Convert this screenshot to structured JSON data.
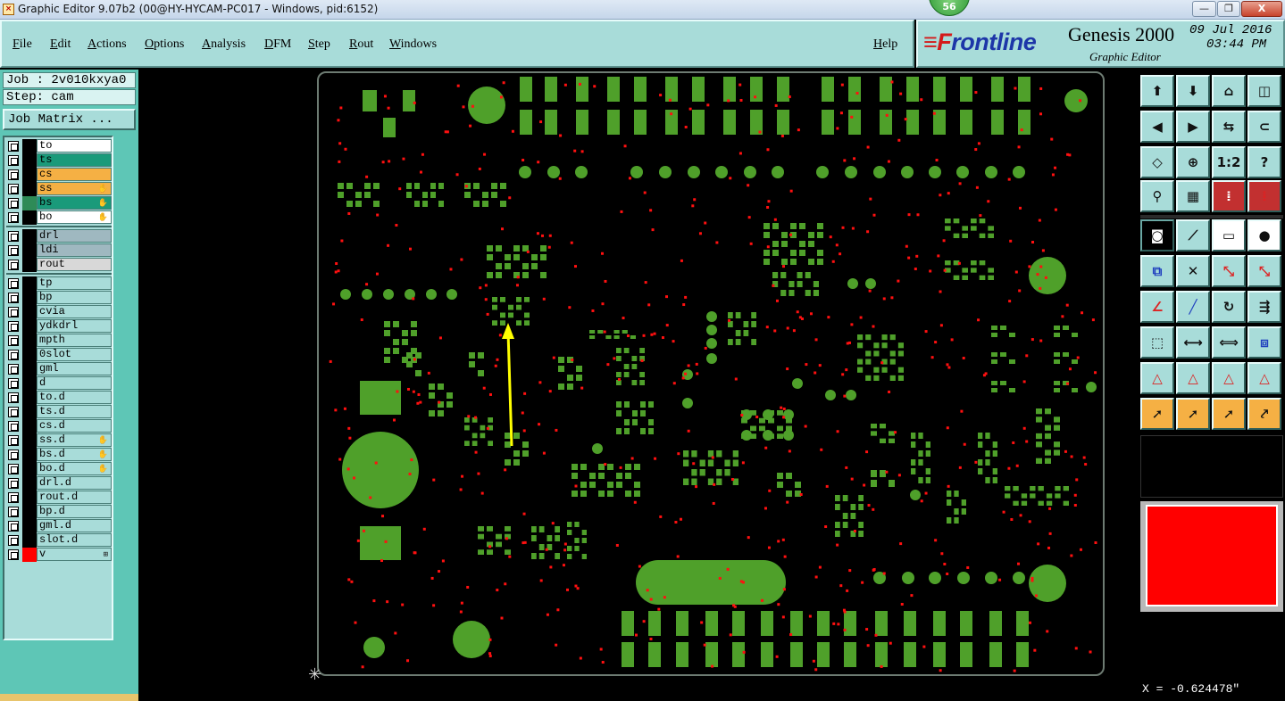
{
  "window": {
    "title": "Graphic Editor 9.07b2 (00@HY-HYCAM-PC017 - Windows, pid:6152)",
    "badge": "56",
    "min_label": "—",
    "max_label": "❐",
    "close_label": "X"
  },
  "menu": {
    "items": [
      "File",
      "Edit",
      "Actions",
      "Options",
      "Analysis",
      "DFM",
      "Step",
      "Rout",
      "Windows"
    ],
    "help": "Help"
  },
  "brand": {
    "logo_f": "≡F",
    "logo_rest": "rontline",
    "product": "Genesis 2000",
    "subtitle": "Graphic Editor",
    "date": "09 Jul 2016",
    "time": "03:44 PM"
  },
  "job": {
    "job_line": "Job : 2v010kxya0",
    "step_line": "Step: cam",
    "matrix_button": "Job Matrix ..."
  },
  "layers": {
    "board": [
      {
        "name": "to",
        "bg": "#ffffff",
        "swatch": "#000000",
        "flag": ""
      },
      {
        "name": "ts",
        "bg": "#1a9a7a",
        "swatch": "#000000",
        "flag": ""
      },
      {
        "name": "cs",
        "bg": "#f5b044",
        "swatch": "#000000",
        "flag": ""
      },
      {
        "name": "ss",
        "bg": "#f5b044",
        "swatch": "#000000",
        "flag": "✋"
      },
      {
        "name": "bs",
        "bg": "#1a9a7a",
        "swatch": "#2e8b57",
        "flag": "✋"
      },
      {
        "name": "bo",
        "bg": "#ffffff",
        "swatch": "#000000",
        "flag": "✋"
      }
    ],
    "drill": [
      {
        "name": "drl",
        "bg": "#9fb8c0",
        "swatch": "#000000",
        "flag": ""
      },
      {
        "name": "ldi",
        "bg": "#9fb8c0",
        "swatch": "#000000",
        "flag": ""
      },
      {
        "name": "rout",
        "bg": "#d8d8d8",
        "swatch": "#000000",
        "flag": ""
      }
    ],
    "misc": [
      {
        "name": "tp",
        "bg": "#a8dcd9",
        "swatch": "#000000",
        "flag": ""
      },
      {
        "name": "bp",
        "bg": "#a8dcd9",
        "swatch": "#000000",
        "flag": ""
      },
      {
        "name": "cvia",
        "bg": "#a8dcd9",
        "swatch": "#000000",
        "flag": ""
      },
      {
        "name": "ydkdrl",
        "bg": "#a8dcd9",
        "swatch": "#000000",
        "flag": ""
      },
      {
        "name": "mpth",
        "bg": "#a8dcd9",
        "swatch": "#000000",
        "flag": ""
      },
      {
        "name": "0slot",
        "bg": "#a8dcd9",
        "swatch": "#000000",
        "flag": ""
      },
      {
        "name": "gml",
        "bg": "#a8dcd9",
        "swatch": "#000000",
        "flag": ""
      },
      {
        "name": "d",
        "bg": "#a8dcd9",
        "swatch": "#000000",
        "flag": ""
      },
      {
        "name": "to.d",
        "bg": "#a8dcd9",
        "swatch": "#000000",
        "flag": ""
      },
      {
        "name": "ts.d",
        "bg": "#a8dcd9",
        "swatch": "#000000",
        "flag": ""
      },
      {
        "name": "cs.d",
        "bg": "#a8dcd9",
        "swatch": "#000000",
        "flag": ""
      },
      {
        "name": "ss.d",
        "bg": "#a8dcd9",
        "swatch": "#000000",
        "flag": "✋"
      },
      {
        "name": "bs.d",
        "bg": "#a8dcd9",
        "swatch": "#000000",
        "flag": "✋"
      },
      {
        "name": "bo.d",
        "bg": "#a8dcd9",
        "swatch": "#000000",
        "flag": "✋"
      },
      {
        "name": "drl.d",
        "bg": "#a8dcd9",
        "swatch": "#000000",
        "flag": ""
      },
      {
        "name": "rout.d",
        "bg": "#a8dcd9",
        "swatch": "#000000",
        "flag": ""
      },
      {
        "name": "bp.d",
        "bg": "#a8dcd9",
        "swatch": "#000000",
        "flag": ""
      },
      {
        "name": "gml.d",
        "bg": "#a8dcd9",
        "swatch": "#000000",
        "flag": ""
      },
      {
        "name": "slot.d",
        "bg": "#a8dcd9",
        "swatch": "#000000",
        "flag": ""
      },
      {
        "name": "v",
        "bg": "#a8dcd9",
        "swatch": "#ff0000",
        "flag": "⊞"
      }
    ]
  },
  "toolbox": {
    "rows": [
      [
        "layer-up-icon",
        "layer-down-icon",
        "home-icon",
        "window-split-icon"
      ],
      [
        "pan-left-icon",
        "pan-right-icon",
        "mirror-icon",
        "snap-icon"
      ],
      [
        "zoom-fit-icon",
        "zoom-center-icon",
        "scale-1-2-icon",
        "help-icon"
      ],
      [
        "measure-icon",
        "grid-icon",
        "traffic-light-icon",
        "traffic-light-red-icon"
      ],
      [
        "pad-icon",
        "line-icon",
        "ruler-icon",
        "circle-pad-icon"
      ],
      [
        "net-icon",
        "cross-icon",
        "connect-icon",
        "connect-red-icon"
      ],
      [
        "angle-icon",
        "line-edit-icon",
        "arc-icon",
        "polarity-icon"
      ],
      [
        "move-icon",
        "split-icon",
        "dimension-icon",
        "group-icon"
      ],
      [
        "surface-icon",
        "surface-edit-icon",
        "surface-move-icon",
        "surface-cut-icon"
      ],
      [
        "select-icon",
        "select-box-icon",
        "select-circle-icon",
        "select-net-icon"
      ]
    ],
    "glyphs": {
      "layer-up-icon": "⬆",
      "layer-down-icon": "⬇",
      "home-icon": "⌂",
      "window-split-icon": "◫",
      "pan-left-icon": "◀",
      "pan-right-icon": "▶",
      "mirror-icon": "⇆",
      "snap-icon": "⊂",
      "zoom-fit-icon": "◇",
      "zoom-center-icon": "⊕",
      "scale-1-2-icon": "1:2",
      "help-icon": "?",
      "measure-icon": "⚲",
      "grid-icon": "▦",
      "traffic-light-icon": "⁞",
      "traffic-light-red-icon": "⁞",
      "pad-icon": "◙",
      "line-icon": "⟋",
      "ruler-icon": "▭",
      "circle-pad-icon": "●",
      "net-icon": "⧉",
      "cross-icon": "✕",
      "connect-icon": "⤡",
      "connect-red-icon": "⤡",
      "angle-icon": "∠",
      "line-edit-icon": "╱",
      "arc-icon": "↻",
      "polarity-icon": "⇶",
      "move-icon": "⬚",
      "split-icon": "⟷",
      "dimension-icon": "⟺",
      "group-icon": "⧈",
      "surface-icon": "△",
      "surface-edit-icon": "△",
      "surface-move-icon": "△",
      "surface-cut-icon": "△",
      "select-icon": "➚",
      "select-box-icon": "➚",
      "select-circle-icon": "➚",
      "select-net-icon": "⤤"
    }
  },
  "status": {
    "coords": "X = -0.624478\""
  },
  "colors": {
    "copper": "#4fa02a",
    "via": "#ff1010",
    "arrow": "#ffff00",
    "panel": "#a8dcd9",
    "panel_dark": "#5ec6b6"
  }
}
